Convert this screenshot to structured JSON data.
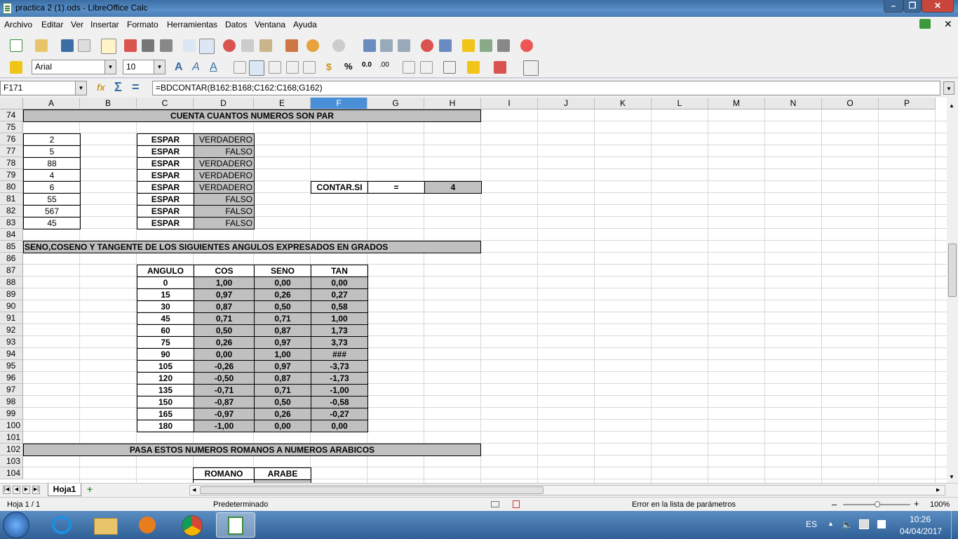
{
  "window": {
    "title": "practica 2 (1).ods - LibreOffice Calc"
  },
  "menu": [
    "Archivo",
    "Editar",
    "Ver",
    "Insertar",
    "Formato",
    "Herramientas",
    "Datos",
    "Ventana",
    "Ayuda"
  ],
  "formatting": {
    "font_name": "Arial",
    "font_size": "10"
  },
  "formula_bar": {
    "cell_ref": "F171",
    "formula": "=BDCONTAR(B162:B168;C162:C168;G162)"
  },
  "columns": [
    "A",
    "B",
    "C",
    "D",
    "E",
    "F",
    "G",
    "H",
    "I",
    "J",
    "K",
    "L",
    "M",
    "N",
    "O",
    "P"
  ],
  "rows": [
    "74",
    "75",
    "76",
    "77",
    "78",
    "79",
    "80",
    "81",
    "82",
    "83",
    "84",
    "85",
    "86",
    "87",
    "88",
    "89",
    "90",
    "91",
    "92",
    "93",
    "94",
    "95",
    "96",
    "97",
    "98",
    "99",
    "100",
    "101",
    "102",
    "103",
    "104"
  ],
  "section1": {
    "title": "CUENTA CUANTOS NUMEROS SON PAR",
    "numbers": [
      "2",
      "5",
      "88",
      "4",
      "6",
      "55",
      "567",
      "45"
    ],
    "labels": [
      "ESPAR",
      "ESPAR",
      "ESPAR",
      "ESPAR",
      "ESPAR",
      "ESPAR",
      "ESPAR",
      "ESPAR"
    ],
    "results": [
      "VERDADERO",
      "FALSO",
      "VERDADERO",
      "VERDADERO",
      "VERDADERO",
      "FALSO",
      "FALSO",
      "FALSO"
    ],
    "contar_label": "CONTAR.SI",
    "equals": "=",
    "count": "4"
  },
  "section2": {
    "title": "SENO,COSENO Y TANGENTE DE LOS SIGUIENTES ANGULOS EXPRESADOS EN GRADOS",
    "headers": [
      "ANGULO",
      "COS",
      "SENO",
      "TAN"
    ],
    "rows": [
      [
        "0",
        "1,00",
        "0,00",
        "0,00"
      ],
      [
        "15",
        "0,97",
        "0,26",
        "0,27"
      ],
      [
        "30",
        "0,87",
        "0,50",
        "0,58"
      ],
      [
        "45",
        "0,71",
        "0,71",
        "1,00"
      ],
      [
        "60",
        "0,50",
        "0,87",
        "1,73"
      ],
      [
        "75",
        "0,26",
        "0,97",
        "3,73"
      ],
      [
        "90",
        "0,00",
        "1,00",
        "###"
      ],
      [
        "105",
        "-0,26",
        "0,97",
        "-3,73"
      ],
      [
        "120",
        "-0,50",
        "0,87",
        "-1,73"
      ],
      [
        "135",
        "-0,71",
        "0,71",
        "-1,00"
      ],
      [
        "150",
        "-0,87",
        "0,50",
        "-0,58"
      ],
      [
        "165",
        "-0,97",
        "0,26",
        "-0,27"
      ],
      [
        "180",
        "-1,00",
        "0,00",
        "0,00"
      ]
    ]
  },
  "section3": {
    "title": "PASA ESTOS NUMEROS ROMANOS A NUMEROS ARABICOS",
    "headers": [
      "ROMANO",
      "ARABE"
    ]
  },
  "tabs": {
    "sheet_tab": "Hoja1"
  },
  "status": {
    "sheet": "Hoja 1 / 1",
    "style": "Predeterminado",
    "message": "Error en la lista de parámetros",
    "zoom": "100%"
  },
  "taskbar": {
    "lang": "ES",
    "time": "10:26",
    "date": "04/04/2017"
  }
}
